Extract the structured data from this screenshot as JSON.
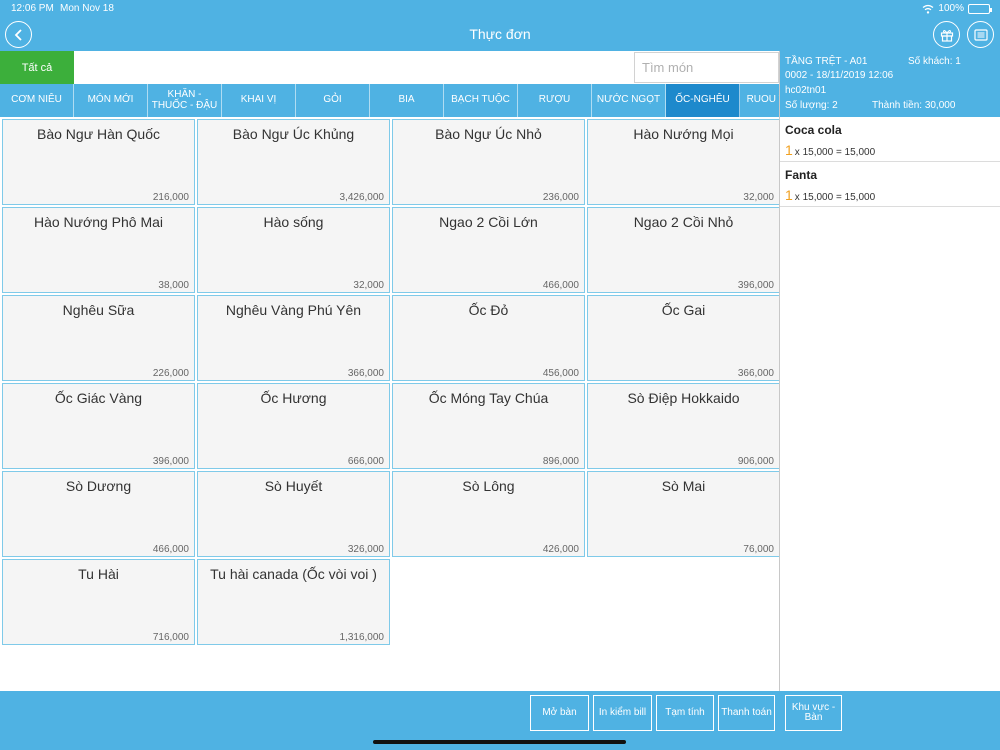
{
  "status": {
    "time": "12:06 PM",
    "date": "Mon Nov 18",
    "battery": "100%"
  },
  "header": {
    "title": "Thực đơn"
  },
  "filter": {
    "all_label": "Tất cả",
    "search_placeholder": "Tìm món"
  },
  "tabs": [
    {
      "label": "CƠM NIÊU"
    },
    {
      "label": "MÓN MỚI"
    },
    {
      "label": "KHĂN - THUỐC - ĐẬU"
    },
    {
      "label": "KHAI VỊ"
    },
    {
      "label": "GỎI"
    },
    {
      "label": "BIA"
    },
    {
      "label": "BẠCH TUỘC"
    },
    {
      "label": "RƯỢU"
    },
    {
      "label": "NƯỚC NGỌT"
    },
    {
      "label": "ỐC-NGHÊU"
    },
    {
      "label": "RUOU VANG"
    }
  ],
  "active_tab": 9,
  "menu": [
    {
      "name": "Bào Ngư Hàn Quốc",
      "price": "216,000"
    },
    {
      "name": "Bào Ngư Úc Khủng",
      "price": "3,426,000"
    },
    {
      "name": "Bào Ngư Úc Nhỏ",
      "price": "236,000"
    },
    {
      "name": "Hào Nướng Mọi",
      "price": "32,000"
    },
    {
      "name": "Hào Nướng Phô Mai",
      "price": "38,000"
    },
    {
      "name": "Hào sống",
      "price": "32,000"
    },
    {
      "name": "Ngao 2 Cồi Lớn",
      "price": "466,000"
    },
    {
      "name": "Ngao 2 Cồi Nhỏ",
      "price": "396,000"
    },
    {
      "name": "Nghêu Sữa",
      "price": "226,000"
    },
    {
      "name": "Nghêu Vàng Phú Yên",
      "price": "366,000"
    },
    {
      "name": "Ốc Đỏ",
      "price": "456,000"
    },
    {
      "name": "Ốc Gai",
      "price": "366,000"
    },
    {
      "name": "Ốc Giác Vàng",
      "price": "396,000"
    },
    {
      "name": "Ốc Hương",
      "price": "666,000"
    },
    {
      "name": "Ốc Móng Tay Chúa",
      "price": "896,000"
    },
    {
      "name": "Sò Điệp Hokkaido",
      "price": "906,000"
    },
    {
      "name": "Sò Dương",
      "price": "466,000"
    },
    {
      "name": "Sò Huyết",
      "price": "326,000"
    },
    {
      "name": "Sò Lông",
      "price": "426,000"
    },
    {
      "name": "Sò Mai",
      "price": "76,000"
    },
    {
      "name": "Tu Hài",
      "price": "716,000"
    },
    {
      "name": "Tu hài canada (Ốc vòi voi )",
      "price": "1,316,000"
    }
  ],
  "order": {
    "table": "TẦNG TRỆT - A01",
    "guests": "Số khách: 1",
    "code": "0002 - 18/11/2019 12:06",
    "user": "hc02tn01",
    "quantity": "Số lượng: 2",
    "total": "Thành tiền: 30,000",
    "items": [
      {
        "name": "Coca cola",
        "qty": "1",
        "line": "x 15,000 = 15,000"
      },
      {
        "name": "Fanta",
        "qty": "1",
        "line": "x 15,000 = 15,000"
      }
    ]
  },
  "actions": [
    {
      "label": "Mở bàn"
    },
    {
      "label": "In kiểm bill"
    },
    {
      "label": "Tạm tính"
    },
    {
      "label": "Thanh toán"
    },
    {
      "label": "Khu vực - Bàn"
    }
  ],
  "colors": {
    "primary": "#4fb2e3",
    "active_tab": "#1d89cc",
    "all_button": "#3caf3b",
    "qty": "#f0a020"
  }
}
